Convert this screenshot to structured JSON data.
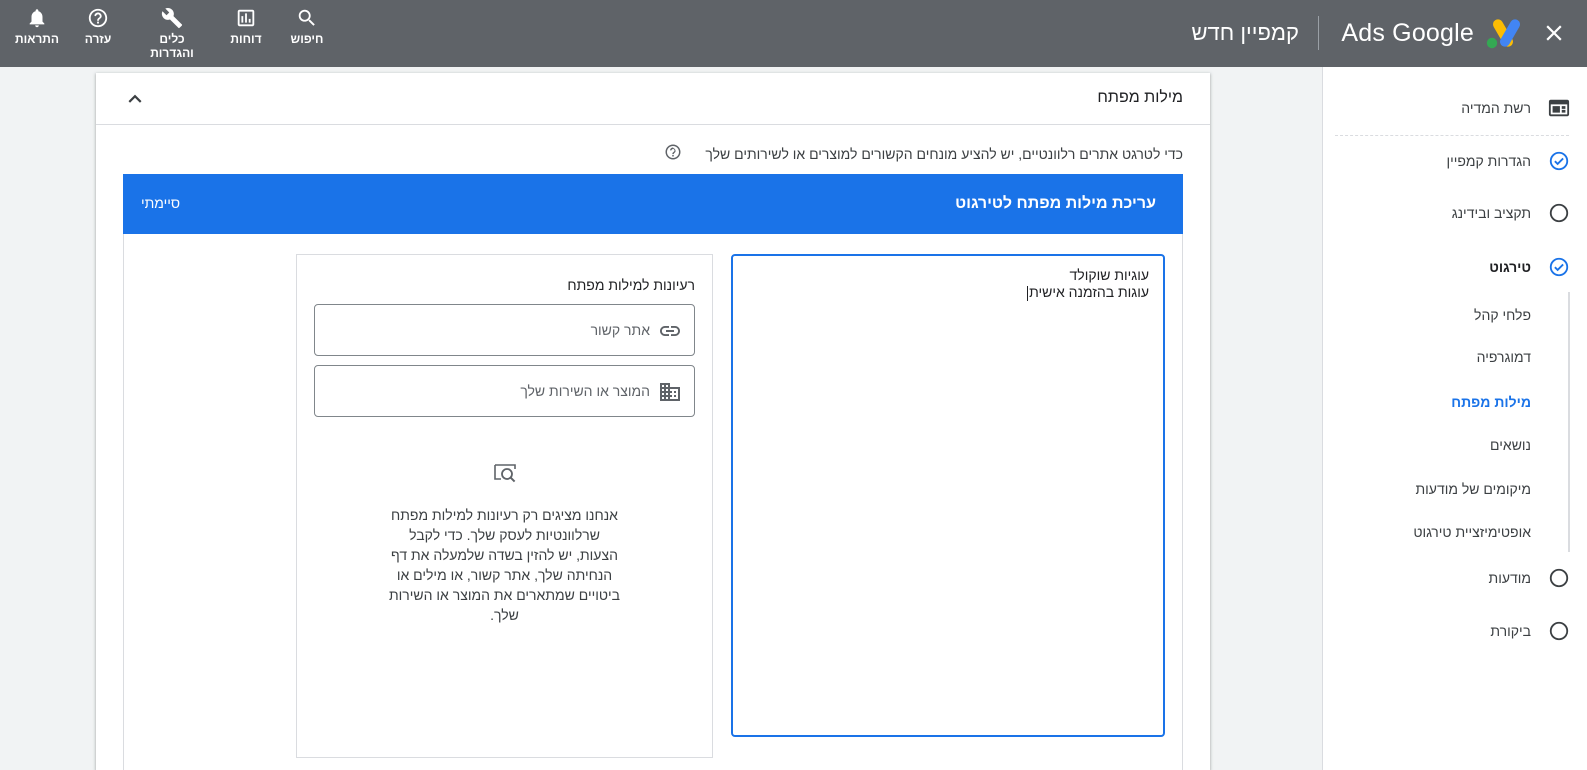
{
  "header": {
    "brand": "Ads Google",
    "campaign_title": "קמפיין חדש",
    "actions": [
      {
        "id": "alerts",
        "label": "התראות",
        "icon": "bell-icon"
      },
      {
        "id": "help",
        "label": "עזרה",
        "icon": "help-icon"
      },
      {
        "id": "tools",
        "label": "כלים והגדרות",
        "icon": "wrench-icon"
      },
      {
        "id": "reports",
        "label": "דוחות",
        "icon": "bar-chart-icon"
      },
      {
        "id": "search",
        "label": "חיפוש",
        "icon": "search-icon"
      }
    ],
    "colors": {
      "bar": "#5f6368",
      "accent": "#1a73e8"
    }
  },
  "sidenav": {
    "items": [
      {
        "label": "רשת המדיה",
        "icon": "display-network-icon"
      },
      {
        "label": "הגדרות קמפיין",
        "icon": "check-circle-icon",
        "state": "done"
      },
      {
        "label": "תקציב ובידינג",
        "icon": "empty-circle-icon",
        "state": "todo"
      },
      {
        "label": "טירגוט",
        "icon": "check-circle-icon",
        "state": "done"
      },
      {
        "label": "מודעות",
        "icon": "empty-circle-icon",
        "state": "todo"
      },
      {
        "label": "ביקורת",
        "icon": "empty-circle-icon",
        "state": "todo"
      }
    ],
    "sub_items": [
      {
        "label": "פלחי קהל"
      },
      {
        "label": "דמוגרפיה"
      },
      {
        "label": "מילות מפתח",
        "active": true
      },
      {
        "label": "נושאים"
      },
      {
        "label": "מיקומים של מודעות"
      },
      {
        "label": "אופטימיזציית טירגוט"
      }
    ]
  },
  "section": {
    "title": "מילות מפתח",
    "help_text": "כדי לטרגט אתרים רלוונטיים, יש להציע מונחים הקשורים למוצרים או לשירותים שלך"
  },
  "editor": {
    "title": "עריכת מילות מפתח לטירגוט",
    "done_label": "סיימתי",
    "keywords": [
      "עוגיות שוקולד",
      "עוגות בהזמנה אישית"
    ]
  },
  "ideas": {
    "title": "רעיונות למילות מפתח",
    "url_placeholder": "אתר קשור",
    "product_placeholder": "המוצר או השירות שלך",
    "note": "אנחנו מציגים רק רעיונות למילות מפתח שרלוונטיות לעסק שלך. כדי לקבל הצעות, יש להזין בשדה שלמעלה את דף הנחיתה שלך, אתר קשור, או מילים או ביטויים שמתארים את המוצר או השירות שלך."
  }
}
